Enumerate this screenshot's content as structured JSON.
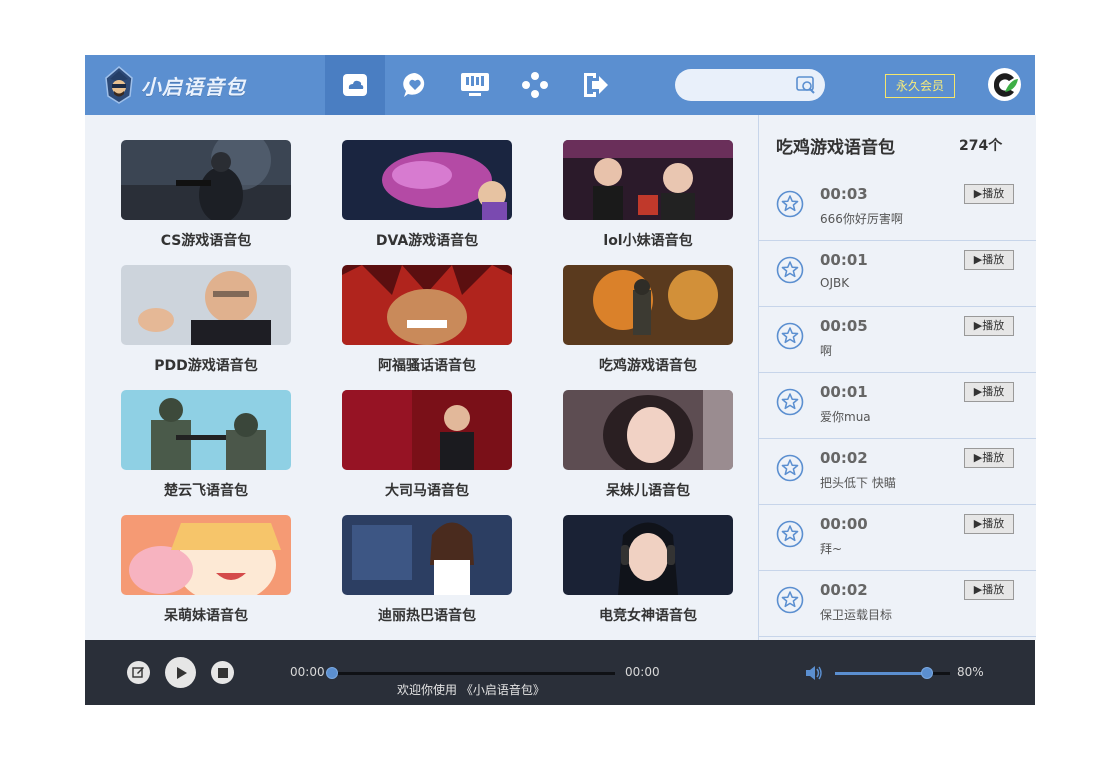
{
  "header": {
    "app_name": "小启语音包",
    "vip_label": "永久会员",
    "search": {
      "placeholder": "",
      "icon": "search-icon"
    },
    "nav": [
      {
        "name": "cloud",
        "icon": "cloud-icon",
        "active": true
      },
      {
        "name": "favorites",
        "icon": "heart-bubble-icon",
        "active": false
      },
      {
        "name": "device",
        "icon": "device-icon",
        "active": false
      },
      {
        "name": "gamepad",
        "icon": "gamepad-icon",
        "active": false
      },
      {
        "name": "exit",
        "icon": "exit-icon",
        "active": false
      }
    ]
  },
  "packs": [
    {
      "label": "CS游戏语音包"
    },
    {
      "label": "DVA游戏语音包"
    },
    {
      "label": "lol小妹语音包"
    },
    {
      "label": "PDD游戏语音包"
    },
    {
      "label": "阿福骚话语音包"
    },
    {
      "label": "吃鸡游戏语音包"
    },
    {
      "label": "楚云飞语音包"
    },
    {
      "label": "大司马语音包"
    },
    {
      "label": "呆妹儿语音包"
    },
    {
      "label": "呆萌妹语音包"
    },
    {
      "label": "迪丽热巴语音包"
    },
    {
      "label": "电竞女神语音包"
    }
  ],
  "panel": {
    "title": "吃鸡游戏语音包",
    "count": "274个",
    "play_label": "▶播放",
    "tracks": [
      {
        "duration": "00:03",
        "name": "666你好厉害啊"
      },
      {
        "duration": "00:01",
        "name": "OJBK"
      },
      {
        "duration": "00:05",
        "name": "啊"
      },
      {
        "duration": "00:01",
        "name": "爱你mua"
      },
      {
        "duration": "00:02",
        "name": "把头低下 快瞄"
      },
      {
        "duration": "00:00",
        "name": "拜~"
      },
      {
        "duration": "00:02",
        "name": "保卫运载目标"
      }
    ]
  },
  "player": {
    "current_time": "00:00",
    "total_time": "00:00",
    "status": "欢迎你使用 《小启语音包》",
    "progress": 0,
    "volume_label": "80%",
    "volume": 0.8
  },
  "colors": {
    "accent": "#5b8fd0",
    "player_bg": "#2a2f39",
    "panel_bg": "#eef2f8"
  }
}
